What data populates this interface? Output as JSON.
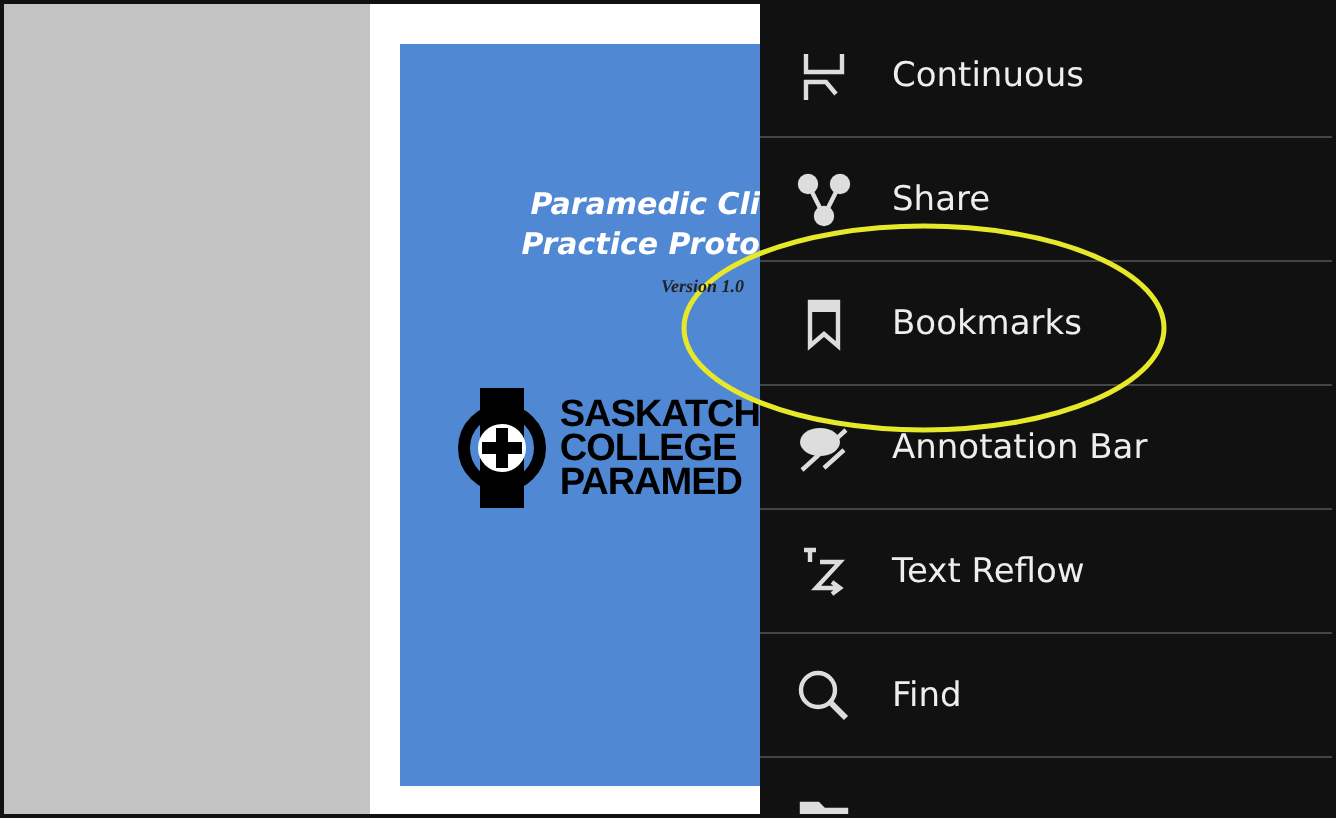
{
  "document": {
    "title_lines": [
      "Paramedic Cli",
      "Practice Proto"
    ],
    "version": "Version 1.0",
    "logo_lines": [
      "SASKATCH",
      "COLLEGE",
      "PARAMED"
    ]
  },
  "menu": {
    "items": [
      {
        "kind": "continuous",
        "label": "Continuous",
        "highlighted": false
      },
      {
        "kind": "share",
        "label": "Share",
        "highlighted": false
      },
      {
        "kind": "bookmark",
        "label": "Bookmarks",
        "highlighted": true
      },
      {
        "kind": "annotation",
        "label": "Annotation Bar",
        "highlighted": false
      },
      {
        "kind": "reflow",
        "label": "Text Reflow",
        "highlighted": false
      },
      {
        "kind": "find",
        "label": "Find",
        "highlighted": false
      },
      {
        "kind": "folder",
        "highlighted": false
      }
    ]
  }
}
